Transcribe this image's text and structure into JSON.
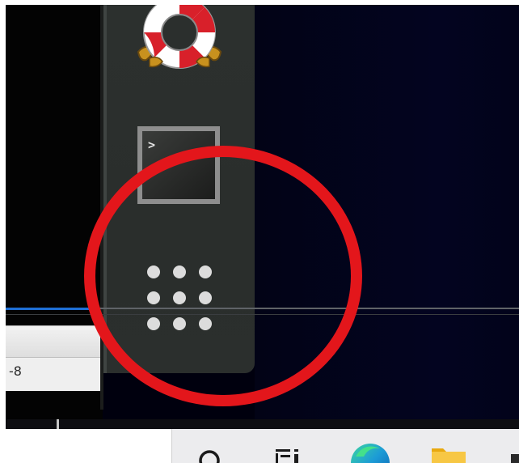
{
  "colors": {
    "desktop_background": "#00000e",
    "dock_background": "#2c302e",
    "annotation": "#e3161b",
    "taskbar_background": "#ececee",
    "accent_line": "#1f6fd6"
  },
  "dock": {
    "items": [
      {
        "name": "help",
        "icon": "lifebuoy-icon"
      },
      {
        "name": "terminal",
        "icon": "terminal-icon",
        "glyph": ">"
      },
      {
        "name": "show-applications",
        "icon": "app-grid-icon"
      }
    ]
  },
  "background_window": {
    "visible_text": "-8"
  },
  "annotation": {
    "shape": "circle",
    "target": "show-applications"
  },
  "taskbar": {
    "items": [
      {
        "icon": "search-icon"
      },
      {
        "icon": "task-view-icon"
      },
      {
        "icon": "edge-browser-icon"
      },
      {
        "icon": "file-explorer-icon"
      }
    ]
  }
}
